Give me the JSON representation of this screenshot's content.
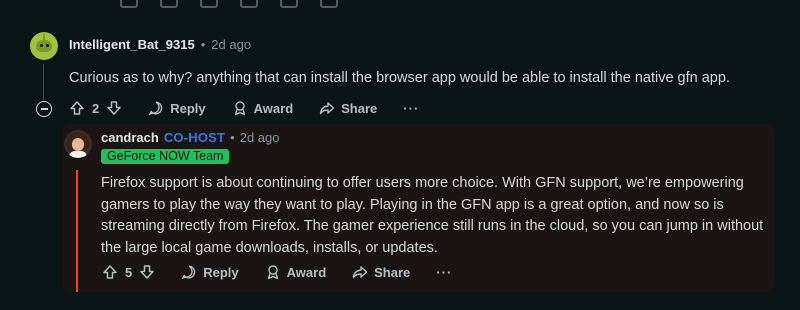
{
  "comments": [
    {
      "author": "Intelligent_Bat_9315",
      "separator": "•",
      "age": "2d ago",
      "body": "Curious as to why? anything that can install the browser app would be able to install the native gfn app.",
      "score": "2",
      "actions": {
        "reply": "Reply",
        "award": "Award",
        "share": "Share",
        "more": "···"
      }
    },
    {
      "author": "candrach",
      "role": "CO-HOST",
      "separator": "•",
      "age": "2d ago",
      "flair": "GeForce NOW Team",
      "body": "Firefox support is about continuing to offer users more choice. With GFN support, we’re empowering gamers to play the way they want to play. Playing in the GFN app is a great option, and now so is streaming directly from Firefox. The gamer experience still runs in the cloud, so you can jump in without the large local game downloads, installs, or updates.",
      "score": "5",
      "actions": {
        "reply": "Reply",
        "award": "Award",
        "share": "Share",
        "more": "···"
      }
    }
  ],
  "colors": {
    "background": "#0b1416",
    "reply_box": "#1b1414",
    "thread_accent": "#ff4500",
    "cohost": "#2f7be8",
    "flair": "#20c05c"
  },
  "icons": [
    "upvote-icon",
    "downvote-icon",
    "comment-icon",
    "award-icon",
    "share-icon",
    "collapse-icon"
  ]
}
